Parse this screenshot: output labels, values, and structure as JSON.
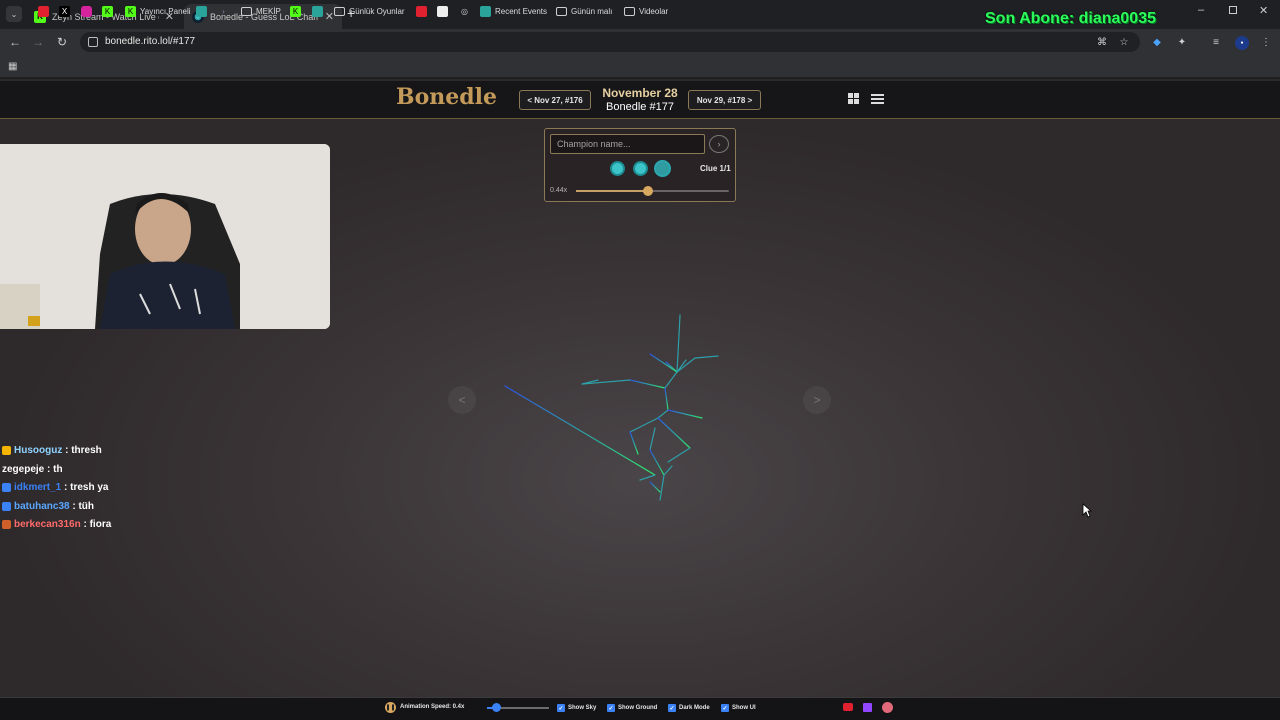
{
  "browser": {
    "tabs": [
      {
        "title": "Zeyn Stream - Watch Live on Kick",
        "favicon": "kick-icon"
      },
      {
        "title": "Bonedle - Guess LoL Champion",
        "favicon": "bonedle-icon"
      }
    ],
    "new_tab_symbol": "+",
    "url": "bonedle.rito.lol/#177",
    "bookmarks": [
      {
        "label": "",
        "icon": "youtube-icon"
      },
      {
        "label": "",
        "icon": "x-icon"
      },
      {
        "label": "",
        "icon": "instagram-icon"
      },
      {
        "label": "",
        "icon": "kick-icon"
      },
      {
        "label": "Yayıncı Paneli",
        "icon": "kick-icon"
      },
      {
        "label": "",
        "icon": "app-icon"
      },
      {
        "label": "",
        "icon": "terminal-icon"
      },
      {
        "label": "MEKİP",
        "icon": "folder-icon"
      },
      {
        "label": "",
        "icon": "kick-icon"
      },
      {
        "label": "",
        "icon": "app-icon"
      },
      {
        "label": "Günlük Oyunlar",
        "icon": "folder-icon"
      },
      {
        "label": "",
        "icon": "youtube-icon"
      },
      {
        "label": "",
        "icon": "game-icon"
      },
      {
        "label": "",
        "icon": "globe-icon"
      },
      {
        "label": "Recent Events",
        "icon": "app-icon"
      },
      {
        "label": "Günün malı",
        "icon": "folder-icon"
      },
      {
        "label": "Videolar",
        "icon": "folder-icon"
      }
    ]
  },
  "overlay": {
    "last_subscriber": "Son Abone: diana0035"
  },
  "site": {
    "logo": "Bonedle",
    "prev_label": "< Nov 27, #176",
    "next_label": "Nov 29, #178 >",
    "date_title": "November 28",
    "date_sub": "Bonedle #177"
  },
  "game": {
    "input_placeholder": "Champion name...",
    "submit_symbol": "›",
    "clue_label": "Clue 1/1",
    "speed_label": "0.44x",
    "speed_value": 0.44,
    "speed_fraction": 0.47,
    "prev_arrow": "<",
    "next_arrow": ">"
  },
  "chat": [
    {
      "user": "Husooguz",
      "message": " : thresh",
      "user_color": "#8fd3ff",
      "badge_color": "#f5b400"
    },
    {
      "user": "zegepeje",
      "message": " : th",
      "user_color": "#ffffff",
      "badge_color": ""
    },
    {
      "user": "idkmert_1",
      "message": " : tresh ya",
      "user_color": "#3b82f6",
      "badge_color": "#3b82f6"
    },
    {
      "user": "batuhanc38",
      "message": " : tüh",
      "user_color": "#5aa7ff",
      "badge_color": "#3b82f6"
    },
    {
      "user": "berkecan316n",
      "message": " : fiora",
      "user_color": "#ff6b6b",
      "badge_color": "#d0602a"
    }
  ],
  "footer": {
    "animation_speed": "Animation Speed: 0.4x",
    "show_sky": "Show Sky",
    "show_ground": "Show Ground",
    "dark_mode": "Dark Mode",
    "show_ui": "Show UI"
  },
  "colors": {
    "accent_gold": "#c49a5a",
    "teal": "#3cc4c9",
    "subscriber_green": "#2dfd5b",
    "skeleton_green": "#2ee86a",
    "skeleton_blue": "#2b55e8"
  }
}
